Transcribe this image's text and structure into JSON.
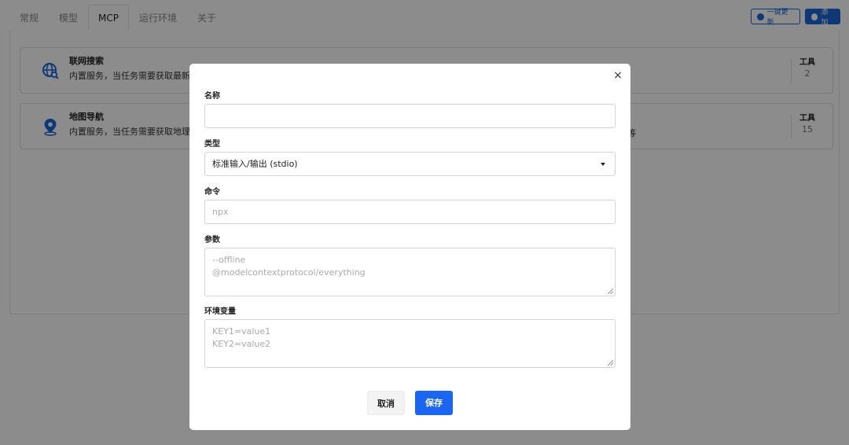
{
  "tabs": [
    {
      "label": "常规",
      "active": false
    },
    {
      "label": "模型",
      "active": false
    },
    {
      "label": "MCP",
      "active": true
    },
    {
      "label": "运行环境",
      "active": false
    },
    {
      "label": "关于",
      "active": false
    }
  ],
  "toolbar": {
    "update_all_label": "一键更新",
    "add_label": "添加"
  },
  "servers": [
    {
      "title": "联网搜索",
      "description": "内置服务，当任务需要获取最新",
      "tools_label": "工具",
      "tools_count": "2",
      "icon": "globe-search-icon"
    },
    {
      "title": "地图导航",
      "description": "内置服务，当任务需要获取地理",
      "description_tail": "等",
      "tools_label": "工具",
      "tools_count": "15",
      "icon": "map-pin-icon"
    }
  ],
  "modal": {
    "close_symbol": "×",
    "name": {
      "label": "名称",
      "value": ""
    },
    "type": {
      "label": "类型",
      "value": "标准输入/输出 (stdio)"
    },
    "command": {
      "label": "命令",
      "placeholder": "npx"
    },
    "args": {
      "label": "参数",
      "placeholder_lines": [
        "--offline",
        "@modelcontextprotocol/everything"
      ]
    },
    "env": {
      "label": "环境变量",
      "placeholder_lines": [
        "KEY1=value1",
        "KEY2=value2"
      ]
    },
    "cancel_label": "取消",
    "save_label": "保存"
  },
  "colors": {
    "accent": "#1a66d8",
    "save_button": "#1a66f0",
    "overlay": "rgba(0,0,0,0.45)"
  }
}
